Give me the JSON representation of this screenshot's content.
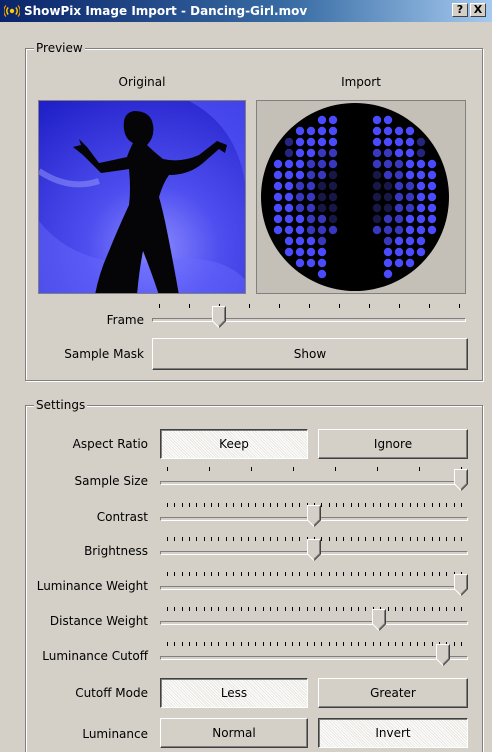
{
  "window": {
    "title": "ShowPix Image Import - Dancing-Girl.mov",
    "help_label": "?",
    "close_label": "X"
  },
  "preview": {
    "group_label": "Preview",
    "original_caption": "Original",
    "import_caption": "Import",
    "frame_label": "Frame",
    "frame_value": 0.2,
    "sample_mask_label": "Sample Mask",
    "show_button": "Show"
  },
  "settings": {
    "group_label": "Settings",
    "aspect_ratio_label": "Aspect Ratio",
    "keep_button": "Keep",
    "ignore_button": "Ignore",
    "aspect_ratio_selected": "Keep",
    "sample_size_label": "Sample Size",
    "sample_size_value": 1.0,
    "contrast_label": "Contrast",
    "contrast_value": 0.5,
    "brightness_label": "Brightness",
    "brightness_value": 0.5,
    "luminance_weight_label": "Luminance Weight",
    "luminance_weight_value": 1.0,
    "distance_weight_label": "Distance Weight",
    "distance_weight_value": 0.72,
    "luminance_cutoff_label": "Luminance Cutoff",
    "luminance_cutoff_value": 0.94,
    "cutoff_mode_label": "Cutoff Mode",
    "less_button": "Less",
    "greater_button": "Greater",
    "cutoff_mode_selected": "Less",
    "luminance_label": "Luminance",
    "normal_button": "Normal",
    "invert_button": "Invert",
    "luminance_selected": "Invert"
  },
  "colors": {
    "window_bg": "#d4d0c8",
    "title_start": "#0a246a",
    "title_end": "#a6caf0",
    "preview_blue": "#3a3ae6",
    "led_bright": "#4a4aff",
    "led_dim": "#1e1e5a"
  }
}
